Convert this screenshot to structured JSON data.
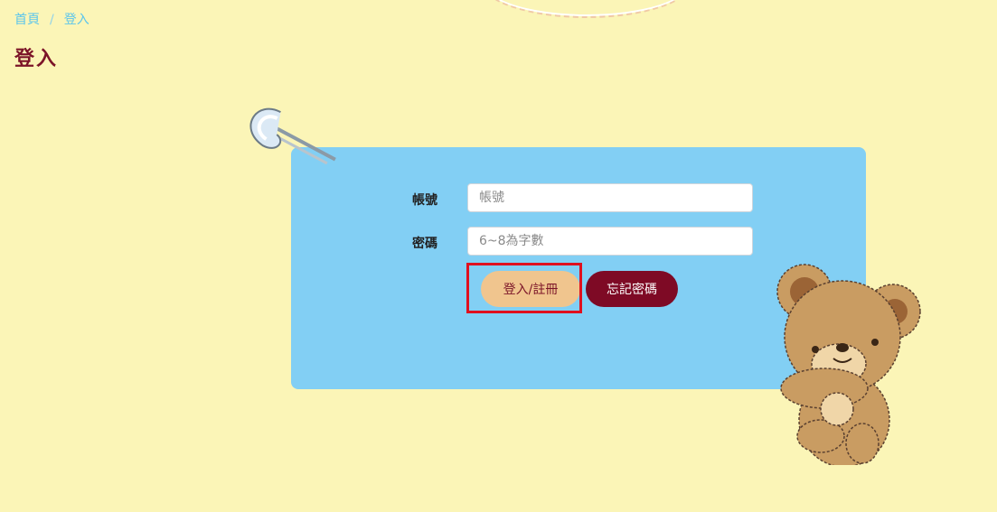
{
  "breadcrumb": {
    "home": "首頁",
    "separator": "/",
    "current": "登入"
  },
  "page": {
    "title": "登入"
  },
  "form": {
    "account_label": "帳號",
    "account_placeholder": "帳號",
    "password_label": "密碼",
    "password_placeholder": "6~8為字數",
    "login_button": "登入/註冊",
    "forgot_button": "忘記密碼"
  },
  "colors": {
    "background": "#fbf5b7",
    "card": "#82cff4",
    "title": "#7b1428",
    "login_button": "#f0c58e",
    "forgot_button": "#7e0a25",
    "highlight": "#e0101e"
  },
  "icons": {
    "pin": "safety-pin-icon",
    "bear": "teddy-bear-icon"
  }
}
